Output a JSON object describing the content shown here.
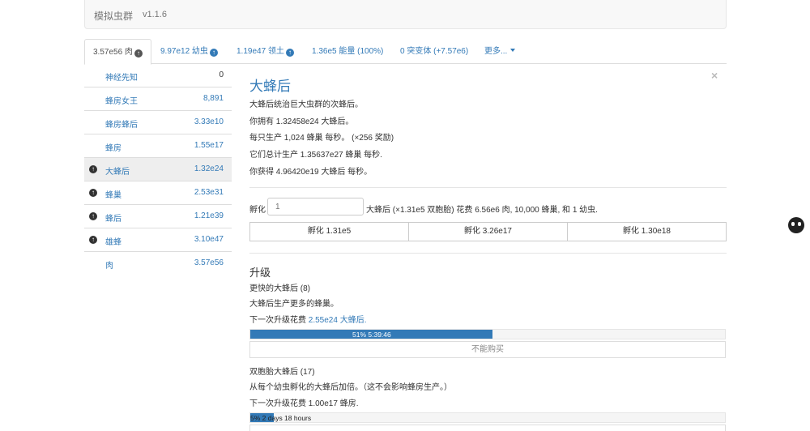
{
  "app": {
    "title": "模拟虫群",
    "version": "v1.1.6"
  },
  "tabs": [
    {
      "label": "3.57e56 肉",
      "icon": "up-arrow-circle-icon"
    },
    {
      "label": "9.97e12 幼虫",
      "icon": "up-arrow-circle-icon"
    },
    {
      "label": "1.19e47 领土",
      "icon": "up-arrow-circle-icon"
    },
    {
      "label": "1.36e5 能量 (100%)"
    },
    {
      "label": "0 突变体 (+7.57e6)"
    },
    {
      "label": "更多..."
    }
  ],
  "sidebar": [
    {
      "name": "神经先知",
      "value": "0",
      "upgrade": false
    },
    {
      "name": "蜂房女王",
      "value": "8,891",
      "upgrade": false
    },
    {
      "name": "蜂房蜂后",
      "value": "3.33e10",
      "upgrade": false
    },
    {
      "name": "蜂房",
      "value": "1.55e17",
      "upgrade": false
    },
    {
      "name": "大蜂后",
      "value": "1.32e24",
      "upgrade": true,
      "selected": true
    },
    {
      "name": "蜂巢",
      "value": "2.53e31",
      "upgrade": true
    },
    {
      "name": "蜂后",
      "value": "1.21e39",
      "upgrade": true
    },
    {
      "name": "雄蜂",
      "value": "3.10e47",
      "upgrade": true
    },
    {
      "name": "肉",
      "value": "3.57e56",
      "upgrade": false
    }
  ],
  "unit": {
    "title": "大蜂后",
    "description": "大蜂后统治巨大虫群的次蜂后。",
    "owned": "你拥有 1.32458e24 大蜂后。",
    "produces_each": "每只生产 1,024 蜂巢 每秒。 (×256 奖励)",
    "produces_total": "它们总计生产 1.35637e27 蜂巢 每秒.",
    "gain": "你获得 4.96420e19 大蜂后 每秒。"
  },
  "hatch": {
    "label": "孵化",
    "input_placeholder": "1",
    "description": "大蜂后 (×1.31e5 双胞胎) 花费 6.56e6 肉, 10,000 蜂巢, 和 1 幼虫.",
    "buttons": [
      "孵化 1.31e5",
      "孵化 3.26e17",
      "孵化 1.30e18"
    ]
  },
  "upgrades": {
    "heading": "升级",
    "items": [
      {
        "name": "更快的大蜂后",
        "level": "(8)",
        "description": "大蜂后生产更多的蜂巢。",
        "cost_prefix": "下一次升级花费 ",
        "cost_value": "2.55e24 大蜂后.",
        "progress_text": "51% 5:39:46",
        "progress_fraction": 0.51,
        "button": "不能购买"
      },
      {
        "name": "双胞胎大蜂后",
        "level": "(17)",
        "description": "从每个幼虫孵化的大蜂后加倍。（这不会影响蜂房生产。）",
        "cost_prefix": "下一次升级花费 ",
        "cost_value": "1.00e17 蜂房.",
        "progress_text": "5% 2 days 18 hours",
        "progress_fraction": 0.05
      }
    ]
  },
  "colors": {
    "link": "#337ab7",
    "progress": "#337ab7",
    "selected_row": "#eeeeee"
  }
}
